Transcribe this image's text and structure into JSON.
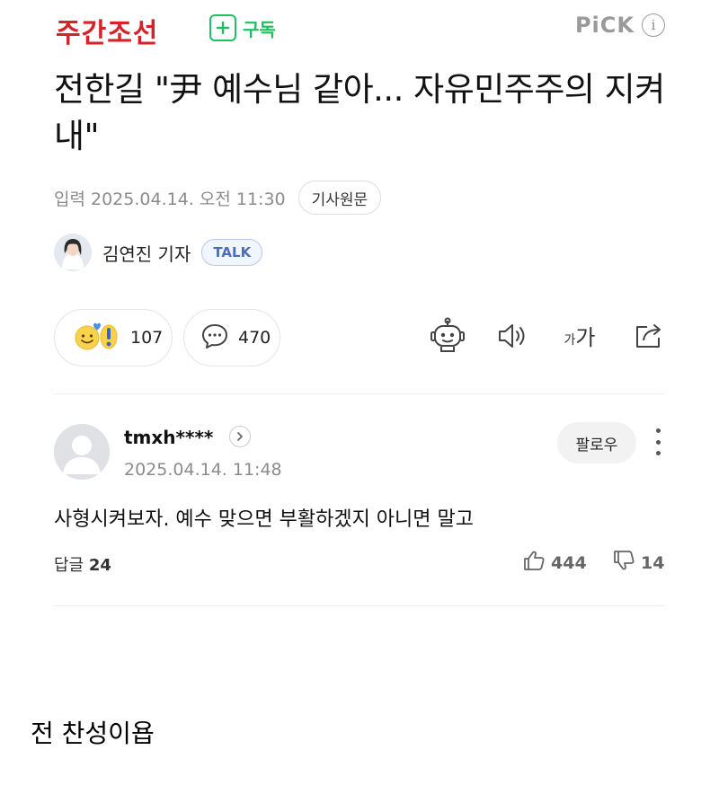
{
  "header": {
    "press_name": "주간조선",
    "subscribe_label": "구독",
    "pick_label": "PiCK",
    "info_glyph": "i"
  },
  "article": {
    "title": "전한길 \"尹 예수님 같아... 자유민주주의 지켜내\"",
    "published": "입력 2025.04.14. 오전 11:30",
    "original_button": "기사원문",
    "reporter_name": "김연진 기자",
    "talk_button": "TALK"
  },
  "reactions": {
    "emotion_count": "107",
    "comment_count": "470"
  },
  "tools": {
    "text_size_label": "가가"
  },
  "comment": {
    "username": "tmxh****",
    "timestamp": "2025.04.14. 11:48",
    "follow_label": "팔로우",
    "body": "사형시켜보자. 예수 맞으면 부활하겠지 아니면 말고",
    "reply_label": "답글",
    "reply_count": "24",
    "likes": "444",
    "dislikes": "14"
  },
  "caption": "전 찬성이욥",
  "colors": {
    "brand_red": "#d62229",
    "subscribe_green": "#1fbf64",
    "talk_blue": "#4b6fb8",
    "muted_gray": "#8b8b8b"
  },
  "icons": [
    "plus-icon",
    "info-icon",
    "emoji-reaction-icon",
    "comment-bubble-icon",
    "ai-robot-icon",
    "speaker-icon",
    "text-size-icon",
    "share-icon",
    "chevron-right-icon",
    "more-vertical-icon",
    "thumbs-up-icon",
    "thumbs-down-icon"
  ]
}
